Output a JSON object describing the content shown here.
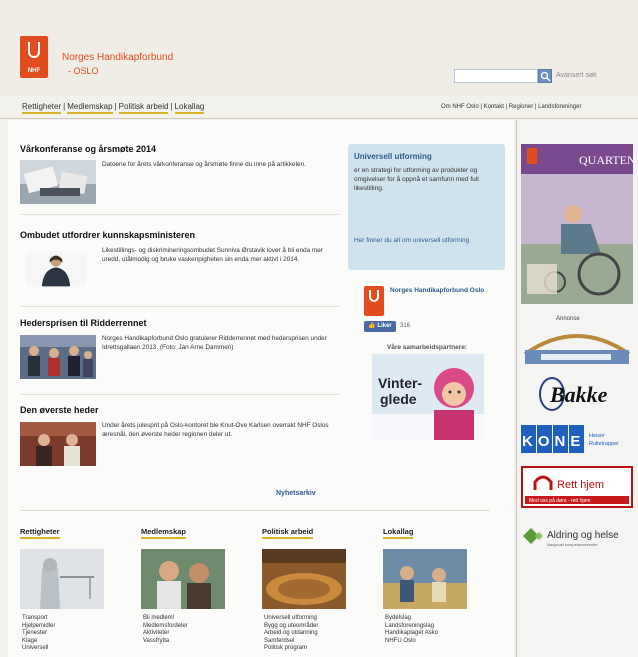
{
  "header": {
    "org_name": "Norges Handikapforbund",
    "org_sub": "- OSLO",
    "logo_abbr": "NHF",
    "search_placeholder": "",
    "advanced_search": "Avansert søk"
  },
  "top_nav": [
    "Rettigheter",
    "Medlemskap",
    "Politisk arbeid",
    "Lokallag"
  ],
  "right_nav": [
    "Om NHF Oslo",
    "Kontakt",
    "Regioner",
    "Landsforeninger"
  ],
  "articles": [
    {
      "title": "Vårkonferanse og årsmøte 2014",
      "text": "Datoene for årets vårkonferanse og årsmøte finne du inne på artikkelen."
    },
    {
      "title": "Ombudet utfordrer kunnskapsministeren",
      "text": "Likestillings- og diskrimineringsombudet Sunniva Ørstavik lover å bli enda mer uredd, utålmodig og bruke vaskenpigheten sin enda mer aktivt i 2014."
    },
    {
      "title": "Hedersprisen til Ridderrennet",
      "text": "Norges Handikapforbund Oslo gratulerer Ridderrennet med hedersprisen under Idrettsgallaen 2013. (Foto: Jan Arne Dammen)"
    },
    {
      "title": "Den øverste heder",
      "text": "Under årets julesprit på Oslo-kontoret ble Knut-Ove Karlsen overrakt NHF Oslos æresnål, den øverste heder regionen deler ut."
    }
  ],
  "info_box": {
    "title": "Universell utforming",
    "text": "er en strategi for utforming av produkter og omgivelser for å oppnå et samfunn med full likestilling.",
    "link": "Her finner du alt om universell utforming"
  },
  "facebook": {
    "name": "Norges Handikapforbund Oslo",
    "like_label": "Liker",
    "like_count": "316"
  },
  "partners_title": "Våre samarbeidspartnere:",
  "winter_ad": {
    "line1": "Vinter-",
    "line2": "glede"
  },
  "news_archive": "Nyhetsarkiv",
  "categories": [
    {
      "title": "Rettigheter",
      "items": [
        "Transport",
        "Hjelpemidler",
        "Tjenester",
        "Klage",
        "Universell"
      ]
    },
    {
      "title": "Medlemskap",
      "items": [
        "Bli medlem!",
        "Medlemsfordeler",
        "Aktiviteter",
        "Vassfrytta"
      ]
    },
    {
      "title": "Politisk arbeid",
      "items": [
        "Universell utforming",
        "Bygg og uteområder",
        "Arbeid og utdanning",
        "Samferdsel",
        "Politisk program"
      ]
    },
    {
      "title": "Lokallag",
      "items": [
        "Bydelslag",
        "Landsforeningslag",
        "Handikaplaget Asko",
        "NHFU Oslo"
      ]
    }
  ],
  "right_ads": {
    "quarten_title": "QUARTEN",
    "annonse": "Annonse",
    "bakke": "Bakke",
    "kone": "KONE",
    "kone_sub": "Heiser Rulletrapper",
    "rett_hjem": "Rett hjem",
    "rett_hjem_sub": "Med oss på døra - rett hjem",
    "aldring": "Aldring og helse",
    "aldring_sub": "Nasjonalt kompetansesenter"
  }
}
